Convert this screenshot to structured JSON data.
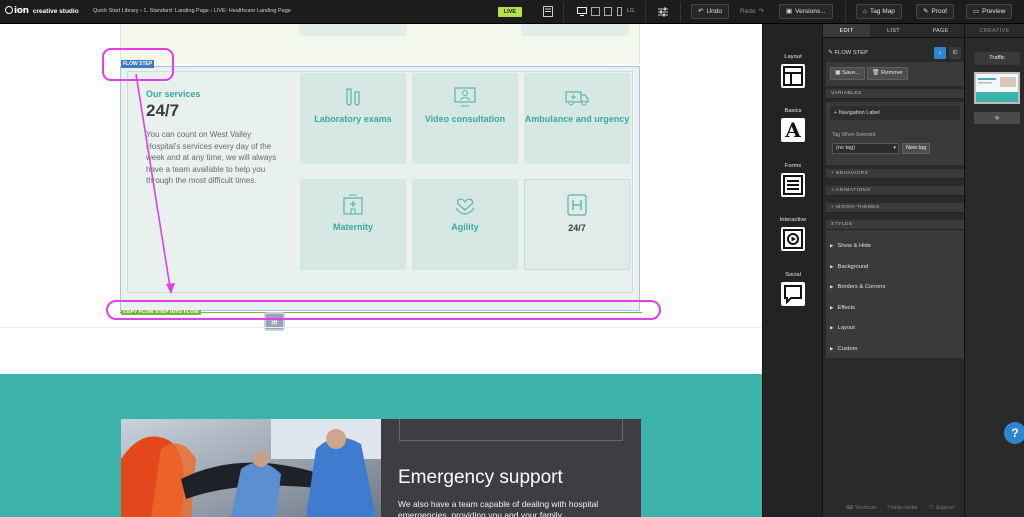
{
  "topbar": {
    "logo": "ion",
    "logo_sub": "creative studio",
    "breadcrumb": "Quick Start Library  ›  1. Standard: Landing Page  ›  LIVE: Healthcare Landing Page",
    "live_badge": "LIVE",
    "undo": "Undo",
    "redo": "Redo",
    "versions": "Versions...",
    "tag_map": "Tag Map",
    "proof": "Proof",
    "preview": "Preview",
    "device_size": "LG"
  },
  "canvas": {
    "flow_step_tag": "FLOW STEP",
    "copy_label": "COPY FLOW STEP INTO FLOW",
    "services": {
      "kicker": "Our services",
      "title": "24/7",
      "description": "You can count on West Valley Hospital's services every day of the week and at any time, we will always have a team available to help you through the most difficult times.",
      "cards": [
        {
          "label": "Laboratory exams",
          "icon": "test-tubes-icon"
        },
        {
          "label": "Video consultation",
          "icon": "video-doctor-icon"
        },
        {
          "label": "Ambulance and urgency",
          "icon": "ambulance-icon"
        },
        {
          "label": "Maternity",
          "icon": "hospital-icon"
        },
        {
          "label": "Agility",
          "icon": "heart-hands-icon"
        },
        {
          "label": "24/7",
          "icon": "h-sign-icon"
        }
      ]
    },
    "emergency": {
      "title": "Emergency support",
      "text": "We also have a team capable of dealing with hospital emergencies, providing you and your family"
    }
  },
  "tools": [
    {
      "label": "Layout",
      "icon": "layout-icon"
    },
    {
      "label": "Basics",
      "icon": "text-a-icon"
    },
    {
      "label": "Forms",
      "icon": "form-list-icon"
    },
    {
      "label": "Interactive",
      "icon": "play-video-icon"
    },
    {
      "label": "Social",
      "icon": "chat-bubble-icon"
    }
  ],
  "props": {
    "tabs": [
      "EDIT",
      "LIST",
      "PAGE"
    ],
    "selected": "FLOW STEP",
    "id_btn": "ID",
    "save": "Save...",
    "remove": "Remove",
    "variables": "VARIABLES",
    "nav_label": "+ Navigation Label",
    "tag_when_selected": "Tag When Selected",
    "tag_value": "(no tag)",
    "new_tag": "New tag",
    "behaviors": "+ BEHAVIORS",
    "animations": "+ ANIMATIONS",
    "micro_themes": "+ MICRO-THEMES",
    "styles": "STYLES",
    "style_items": [
      "Show & Hide",
      "Background",
      "Borders & Corners",
      "Effects",
      "Layout",
      "Custom"
    ]
  },
  "footer": {
    "shortcuts": "Shortcuts",
    "help_center": "Help center",
    "support": "Support"
  },
  "creative": {
    "header": "CREATIVE",
    "traffic": "Traffic",
    "add": "+"
  },
  "help_button": "?",
  "colors": {
    "accent_teal": "#3bb3ab",
    "highlight_magenta": "#e040e6",
    "live_green": "#b6e04a",
    "selection_blue": "#3e78c0"
  }
}
